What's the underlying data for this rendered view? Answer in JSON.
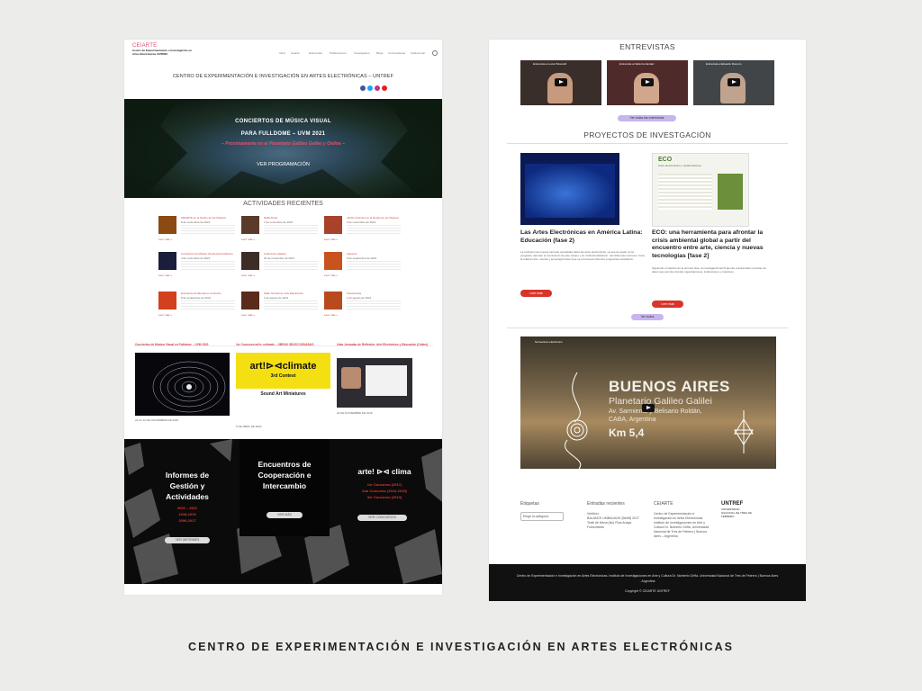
{
  "caption": "CENTRO DE EXPERIMENTACIÓN E INVESTIGACIÓN EN ARTES ELECTRÓNICAS",
  "colors": {
    "accent_red": "#d8342a",
    "pink": "#e24a7a",
    "purple": "#c6b5ee",
    "dark": "#0b0b0b"
  },
  "left": {
    "logo": "CEIARTE",
    "logo_sub": "Centro de Experimentación e Investigación en Artes Electrónicas UNTREF",
    "nav": [
      "Inicio",
      "Ceiarte",
      "Entrevistas",
      "Publicaciones",
      "Investigación",
      "Blogs",
      "Convocatorias",
      "Institucional",
      "search-icon"
    ],
    "org_title": "CENTRO DE EXPERIMENTACIÓN E INVESTIGACIÓN EN ARTES ELECTRÓNICAS – UNTREF",
    "social": [
      {
        "icon": "facebook-icon",
        "color": "#3b5998"
      },
      {
        "icon": "twitter-icon",
        "color": "#1da1f2"
      },
      {
        "icon": "instagram-icon",
        "color": "#c13584"
      },
      {
        "icon": "youtube-icon",
        "color": "#e62117"
      }
    ],
    "hero": {
      "line1": "CONCIERTOS DE MÚSICA VISUAL",
      "line2": "PARA FULLDOME – UVM 2021",
      "subtitle": "– Próximamente en el Planetario Galileo Galilei y Online –",
      "button": "VER PROGRAMACIÓN"
    },
    "activities_title": "ACTIVIDADES RECIENTES",
    "activities": [
      {
        "title": "CEIARTE en la Noche de los Museos",
        "date": "8 de noviembre de 2021",
        "read": "Leer más »",
        "color": "#8a4a12"
      },
      {
        "title": "Nella Rossi",
        "date": "7 de noviembre de 2021",
        "read": "Leer más »",
        "color": "#5b3a2a"
      },
      {
        "title": "Jardín Cósmico en la Noche de los Museos",
        "date": "6 de noviembre de 2021",
        "read": "Leer más »",
        "color": "#a8422a"
      },
      {
        "title": "Conciertos de Música Visual para Fulldome",
        "date": "4 de noviembre de 2021",
        "read": "Leer más »",
        "color": "#1a1e3a"
      },
      {
        "title": "Cultura de Hackeo",
        "date": "20 de noviembre de 2021",
        "read": "Leer más »",
        "color": "#3c2d26"
      },
      {
        "title": "Laborios",
        "date": "9 de septiembre de 2021",
        "read": "Leer más »",
        "color": "#c8531f"
      },
      {
        "title": "Encuentro Ambiental en la Noche",
        "date": "8 de septiembre de 2021",
        "read": "Leer más »",
        "color": "#d2401d"
      },
      {
        "title": "Taller Territorios, Arte Electrónico",
        "date": "1 de agosto de 2021",
        "read": "Leer más »",
        "color": "#5a2a1a"
      },
      {
        "title": "Fotosíntesis",
        "date": "1 de agosto de 2021",
        "read": "Leer más »",
        "color": "#b84a1e"
      }
    ],
    "news": [
      {
        "title": "Conciertos de Música Visual en Fulldome – UVM 2020",
        "date": "24 AL 30 DE NOVIEMBRE DE 2020"
      },
      {
        "title": "1er Concurso art!⊳⊲climate – OBRAS SELECCIONADAS",
        "date": "5 DE ABRIL DE 2020",
        "poster_line1": "art!⊳⊲climate",
        "poster_line2": "3rd Contest",
        "poster_line3": "Sound Art Miniatures"
      },
      {
        "title": "2das Jornadas de Reflexión: Arte Electrónico y Educación (Online)",
        "date": "20 DE NOVIEMBRE DE 2019"
      }
    ],
    "box1": {
      "title": "Informes de Gestión y Actividades",
      "years": [
        "2020 – 2021",
        "2018-2019",
        "2006-2017"
      ],
      "button": "VER INFORMES"
    },
    "box2": {
      "title": "Encuentros de Cooperación e Intercambio",
      "button": "VER MÁS"
    },
    "box3": {
      "title": "arte! ⊳⊲ clima",
      "contests": [
        "1er Concurso (2017)",
        "2do Concurso (2014-2015)",
        "3er Concurso (2013)"
      ],
      "button": "VER CONCURSOS"
    }
  },
  "right": {
    "interviews_title": "ENTREVISTAS",
    "videos": [
      {
        "label": "Entrevista a Lucía Polverelli"
      },
      {
        "label": "Entrevista a Nella Fernández"
      },
      {
        "label": "Entrevista a Eduardo Romero"
      }
    ],
    "interviews_button": "Ver todas las entrevistas",
    "projects_title": "PROYECTOS DE INVESTGACIÓN",
    "projects": [
      {
        "title": "Las Artes Electrónicas en América Latina: Educación (fase 2)",
        "text": "La profusión de nuevas carreras orientadas hacia las artes electrónicas, ya sea de grado como posgrado, denotan el crecimiento de este campo y su institucionalización. Las diferentes razones: crece la relación arte, ciencia y tecnología hacen que se promuevan diversos programas educativos.",
        "button": "Leer más"
      },
      {
        "title": "ECO: una herramienta para afrontar la crisis ambiental global a partir del encuentro entre arte, ciencia y nuevas tecnologías [fase 2]",
        "text": "Siguiendo el objetivo de la primera fase, la investigación ECO apunta a desarrollar una base de datos que permita vincular organizaciones, instituciones y colectivos.",
        "button": "Leer más",
        "image_label": "ECO",
        "image_sub": "Artes electrónicas y medioambiente."
      }
    ],
    "projects_button": "Ver todos",
    "big_video": {
      "label": "Nonvertimo electrónico",
      "title": "BUENOS AIRES",
      "subtitle": "Planetario Galileo Galilei",
      "address": "Av. Sarmiento y Belisario Roldán,",
      "city": "CABA, Argentina",
      "km": "Km 5,4"
    },
    "footer": {
      "col1_title": "Etiquetas",
      "select_placeholder": "Elegir la categoría",
      "col2_title": "Entradas recientes",
      "col2_items": [
        "Vertíbrio",
        "BALANCE UMBAUAGE (BeeB) 2017",
        "Textil de Mena (sin) Ríos Anaya",
        "Fotosíntesis"
      ],
      "col3_title": "CEIARTE",
      "col3_text": "Centro de Experimentación e Investigación en Artes Electrónicas Instituto de Investigaciones en Arte y Cultura Dr. Norberto Griffa, Universidad Nacional de Tres de Febrero | Buenos Aires – Argentina",
      "col4_logo": "UNTREF",
      "col4_sub": "UNIVERSIDAD NACIONAL DE TRES DE FEBRERO"
    },
    "bottom_bar": {
      "text": "Centro de Experimentación e Investigación en Artes Electrónicas. Instituto de Investigaciones en Arte y Cultura Dr. Norberto Griffa. Universidad Nacional de Tres de Febrero | Buenos Aires - Argentina",
      "copyright": "Copyright © CEIARTE UNTREF"
    }
  }
}
